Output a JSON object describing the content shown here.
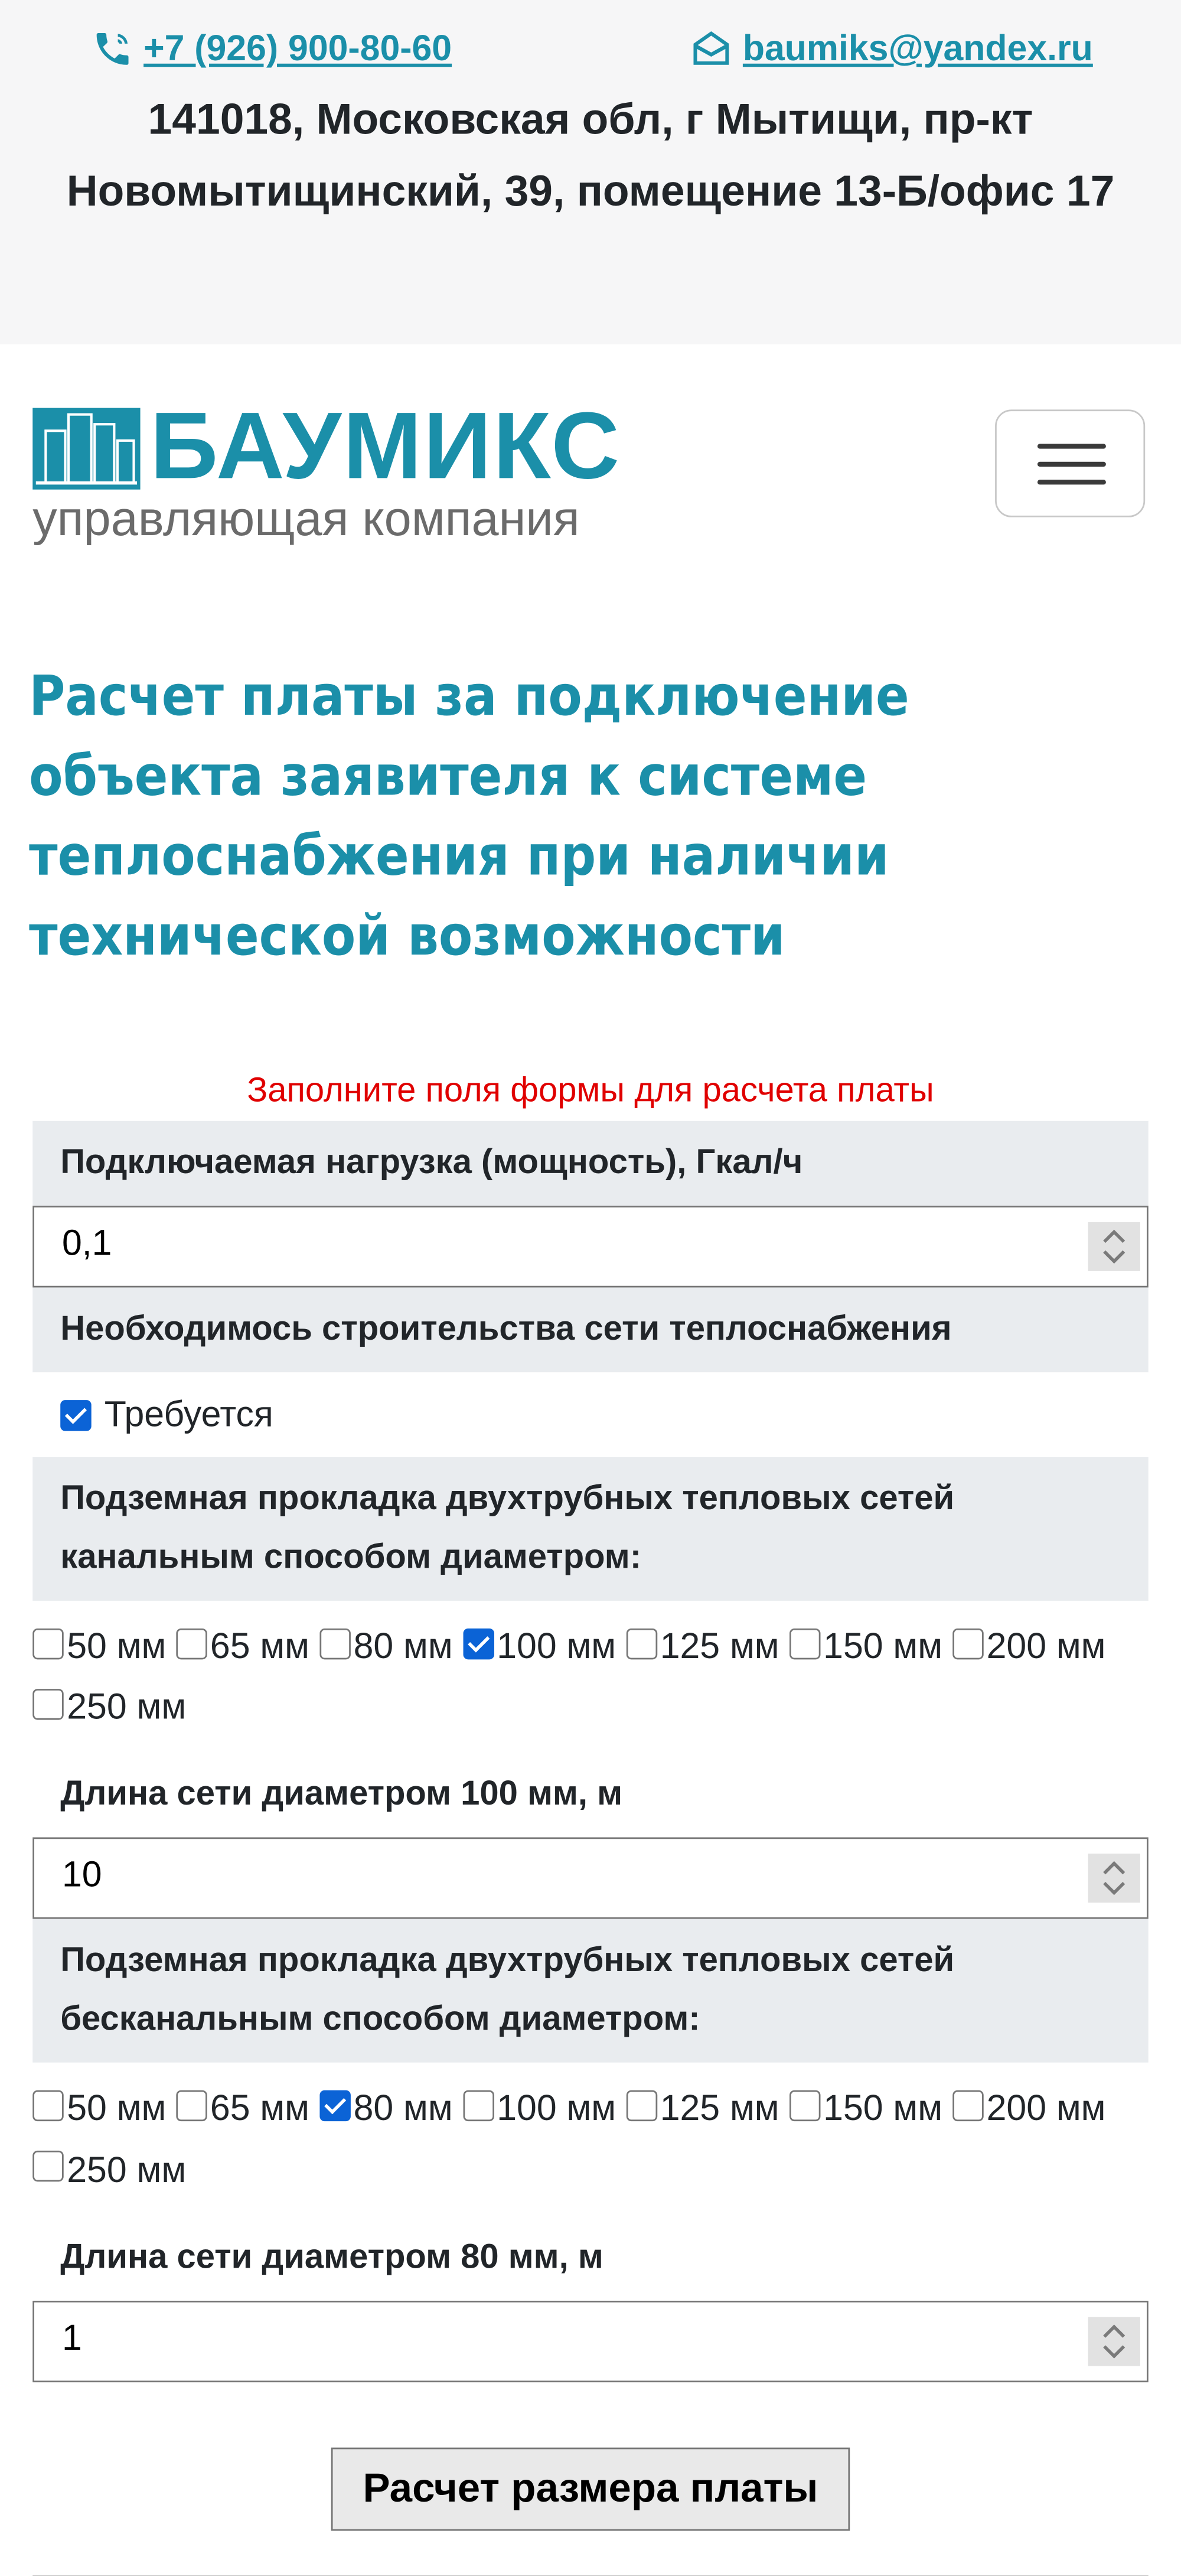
{
  "topbar": {
    "phone": "+7 (926) 900-80-60",
    "email": "baumiks@yandex.ru",
    "address": "141018, Московская обл, г Мытищи, пр-кт Новомытищинский, 39, помещение 13-Б/офис 17"
  },
  "header": {
    "logo_name": "БАУМИКС",
    "logo_subtitle": "управляющая компания"
  },
  "page_title": "Расчет платы за подключение объекта заявителя к системе теплоснабжения при наличии технической возможности",
  "form_hint": "Заполните поля формы для расчета платы",
  "form": {
    "load_label": "Подключаемая нагрузка (мощность), Гкал/ч",
    "load_value": "0,1",
    "construction_label": "Необходимось строительства сети теплоснабжения",
    "construction_checkbox": "Требуется",
    "channel_label": "Подземная прокладка двухтрубных тепловых сетей канальным способом диаметром:",
    "channel_options": [
      "50 мм",
      "65 мм",
      "80 мм",
      "100 мм",
      "125 мм",
      "150 мм",
      "200 мм",
      "250 мм"
    ],
    "channel_selected": "100 мм",
    "channel_length_label": "Длина сети диаметром 100 мм, м",
    "channel_length_value": "10",
    "channelless_label": "Подземная прокладка двухтрубных тепловых сетей бесканальным способом диаметром:",
    "channelless_options": [
      "50 мм",
      "65 мм",
      "80 мм",
      "100 мм",
      "125 мм",
      "150 мм",
      "200 мм",
      "250 мм"
    ],
    "channelless_selected": "80 мм",
    "channelless_length_label": "Длина сети диаметром 80 мм, м",
    "channelless_length_value": "1",
    "submit_label": "Расчет размера платы"
  },
  "icons": {
    "phone": "phone-icon",
    "email": "envelope-icon",
    "menu": "hamburger-icon"
  },
  "colors": {
    "brand": "#1b8fa9",
    "hint": "#e00000",
    "label_bg": "#e9ecef",
    "checkbox_on": "#0b63d6"
  }
}
